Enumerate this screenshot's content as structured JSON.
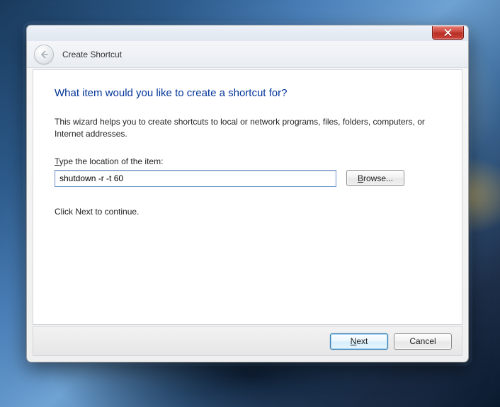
{
  "window": {
    "title": "Create Shortcut"
  },
  "content": {
    "heading": "What item would you like to create a shortcut for?",
    "description": "This wizard helps you to create shortcuts to local or network programs, files, folders, computers, or Internet addresses.",
    "field_label_pre": "T",
    "field_label_rest": "ype the location of the item:",
    "input_value": "shutdown -r -t 60",
    "browse_pre": "B",
    "browse_rest": "rowse...",
    "hint": "Click Next to continue."
  },
  "footer": {
    "next_pre": "N",
    "next_rest": "ext",
    "cancel": "Cancel"
  }
}
